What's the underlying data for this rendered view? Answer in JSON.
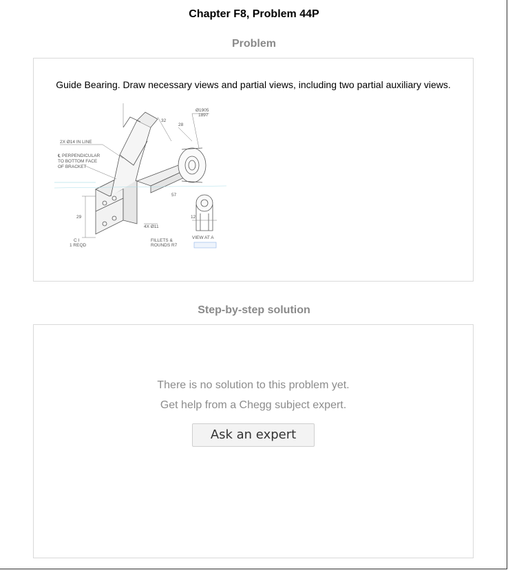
{
  "page": {
    "title": "Chapter F8, Problem 44P"
  },
  "problem": {
    "heading": "Problem",
    "text": "Guide Bearing. Draw necessary views and partial views, including two partial auxiliary views.",
    "figure": {
      "labels": {
        "holes": "2X Ø14 IN LINE",
        "perp_1": "℄ PERPENDICULAR",
        "perp_2": "TO BOTTOM FACE",
        "perp_3": "OF BRACKET",
        "holes_4x": "4X Ø11",
        "fillets_1": "FILLETS &",
        "fillets_2": "ROUNDS R7",
        "view_1": "VIEW AT A",
        "ci_1": "C I",
        "ci_2": "1 REQD",
        "dia_1": "Ø1905",
        "dia_2": "1897",
        "dim_28": "28",
        "dim_32": "32",
        "dim_29": "29",
        "dim_57": "57",
        "dim_12": "12"
      }
    }
  },
  "solution": {
    "heading": "Step-by-step solution",
    "line1": "There is no solution to this problem yet.",
    "line2": "Get help from a Chegg subject expert.",
    "button_label": "Ask an expert"
  }
}
